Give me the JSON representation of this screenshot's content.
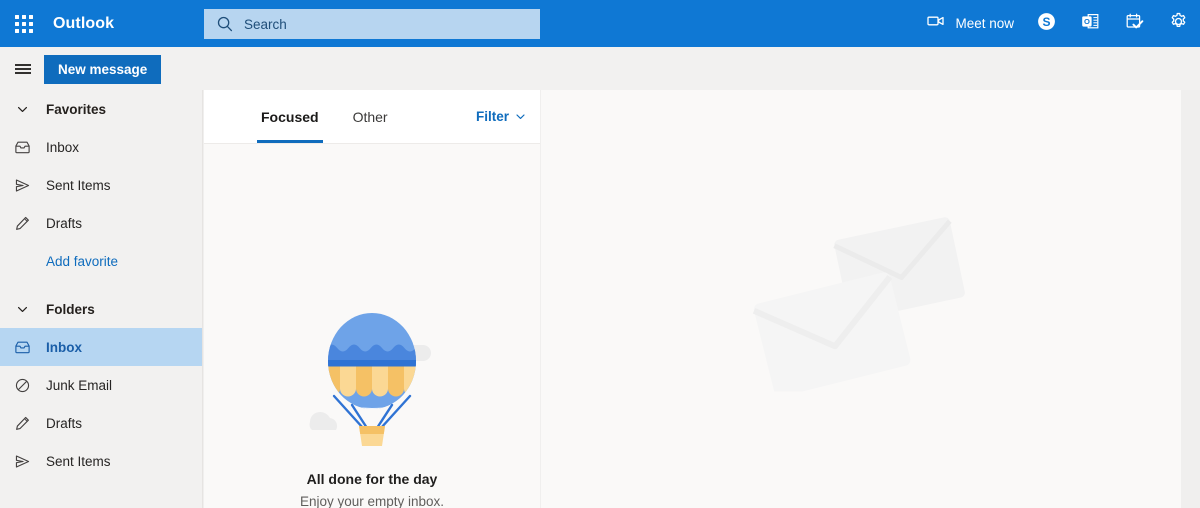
{
  "header": {
    "app_launcher_icon": "waffle-grid-icon",
    "brand": "Outlook",
    "search": {
      "icon": "search-icon",
      "placeholder": "Search",
      "value": ""
    },
    "actions": [
      {
        "name": "meet-now",
        "icon": "video-camera-icon",
        "label": "Meet now"
      },
      {
        "name": "skype",
        "icon": "skype-icon",
        "label": ""
      },
      {
        "name": "outlook-app",
        "icon": "outlook-app-icon",
        "label": ""
      },
      {
        "name": "tasks",
        "icon": "task-checkmark-icon",
        "label": ""
      },
      {
        "name": "settings",
        "icon": "gear-icon",
        "label": ""
      }
    ]
  },
  "command_bar": {
    "menu_icon": "hamburger-icon",
    "new_message_label": "New message"
  },
  "sidebar": {
    "groups": [
      {
        "name": "favorites",
        "title": "Favorites",
        "chevron": "chevron-down-icon",
        "items": [
          {
            "label": "Inbox",
            "icon": "inbox-icon",
            "selected": false
          },
          {
            "label": "Sent Items",
            "icon": "send-icon",
            "selected": false
          },
          {
            "label": "Drafts",
            "icon": "pencil-icon",
            "selected": false
          }
        ],
        "add_link": "Add favorite"
      },
      {
        "name": "folders",
        "title": "Folders",
        "chevron": "chevron-down-icon",
        "items": [
          {
            "label": "Inbox",
            "icon": "inbox-icon",
            "selected": true
          },
          {
            "label": "Junk Email",
            "icon": "block-icon",
            "selected": false
          },
          {
            "label": "Drafts",
            "icon": "pencil-icon",
            "selected": false
          },
          {
            "label": "Sent Items",
            "icon": "send-icon",
            "selected": false
          }
        ]
      }
    ]
  },
  "message_list": {
    "tabs": [
      {
        "label": "Focused",
        "active": true
      },
      {
        "label": "Other",
        "active": false
      }
    ],
    "filter": {
      "label": "Filter",
      "icon": "chevron-down-icon"
    },
    "empty_state": {
      "illustration": "hot-air-balloon-illustration",
      "title": "All done for the day",
      "subtitle": "Enjoy your empty inbox."
    }
  },
  "reading_pane": {
    "watermark": "envelopes-illustration"
  },
  "colors": {
    "header_blue": "#0f78d4",
    "accent_blue": "#0f6cbd",
    "search_field": "#b7d5f0",
    "selection": "#b6d6f2",
    "sidebar_bg": "#f2f1f0",
    "pane_bg": "#faf9f8",
    "balloon_blue": "#5b9bea",
    "balloon_yellow": "#f6c36b"
  }
}
